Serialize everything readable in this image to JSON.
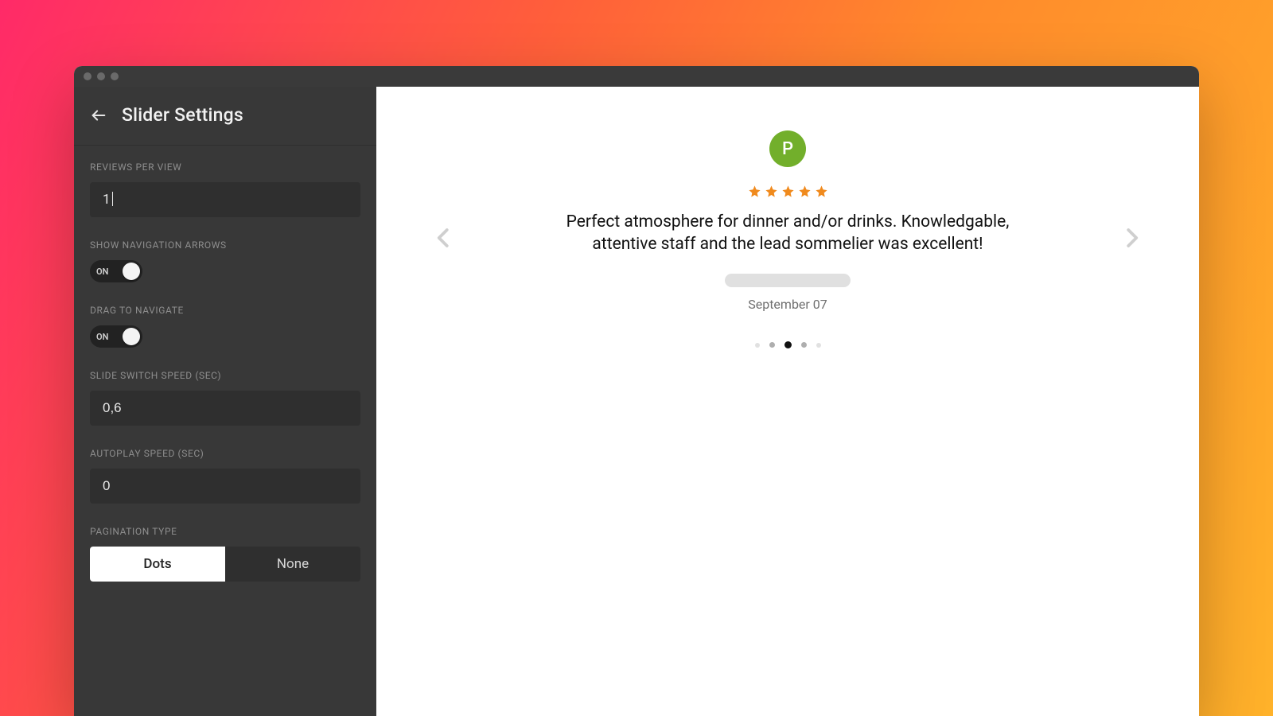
{
  "header": {
    "title": "Slider Settings"
  },
  "fields": {
    "reviews_per_view": {
      "label": "REVIEWS PER VIEW",
      "value": "1"
    },
    "show_nav_arrows": {
      "label": "SHOW NAVIGATION ARROWS",
      "state": "ON"
    },
    "drag_to_navigate": {
      "label": "DRAG TO NAVIGATE",
      "state": "ON"
    },
    "slide_switch_speed": {
      "label": "SLIDE SWITCH SPEED (SEC)",
      "value": "0,6"
    },
    "autoplay_speed": {
      "label": "AUTOPLAY SPEED (SEC)",
      "value": "0"
    },
    "pagination_type": {
      "label": "PAGINATION TYPE",
      "options": [
        "Dots",
        "None"
      ],
      "selected": "Dots"
    }
  },
  "preview": {
    "avatar_initial": "P",
    "rating": 5,
    "review_text": "Perfect atmosphere for dinner and/or drinks. Knowledgable, attentive staff and the lead sommelier was excellent!",
    "date": "September 07",
    "pagination": {
      "count": 5,
      "active_index": 2
    }
  },
  "colors": {
    "sidebar_bg": "#383838",
    "accent_star": "#f08a1d",
    "avatar_bg": "#72af2b"
  }
}
